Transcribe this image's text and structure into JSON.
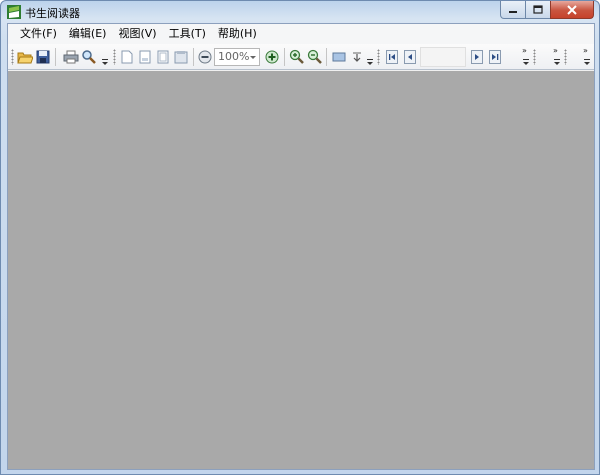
{
  "window": {
    "title": "书生阅读器",
    "controls": {
      "minimize": "minimize",
      "maximize": "maximize",
      "close": "close"
    }
  },
  "menu": [
    {
      "label": "文件(F)"
    },
    {
      "label": "编辑(E)"
    },
    {
      "label": "视图(V)"
    },
    {
      "label": "工具(T)"
    },
    {
      "label": "帮助(H)"
    }
  ],
  "toolbar": {
    "zoom_value": "100%",
    "page_value": "",
    "icons": [
      "open-folder-icon",
      "save-icon",
      "print-icon",
      "search-icon",
      "page-single-icon",
      "page-fit-icon",
      "page-double-icon",
      "page-facing-icon",
      "zoom-out-circle-icon",
      "zoom-in-circle-icon",
      "magnify-plus-icon",
      "magnify-minus-icon",
      "screen-icon",
      "scroll-down-icon",
      "first-page-icon",
      "prev-page-icon",
      "next-page-icon",
      "last-page-icon"
    ]
  },
  "colors": {
    "document_area": "#a9a9a9",
    "title_gradient_top": "#bcd3ec",
    "close_button": "#c6422b"
  }
}
